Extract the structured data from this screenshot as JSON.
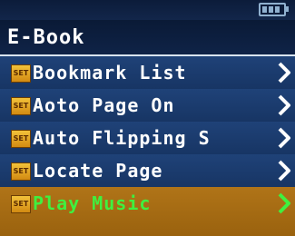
{
  "title": "E-Book",
  "status": {
    "battery_icon": "battery-icon"
  },
  "menu": {
    "items": [
      {
        "label": "Bookmark List",
        "icon_text": "SET",
        "icon": "set-icon",
        "selected": false
      },
      {
        "label": "Aoto Page On",
        "icon_text": "SET",
        "icon": "set-icon",
        "selected": false
      },
      {
        "label": "Auto Flipping S",
        "icon_text": "SET",
        "icon": "set-icon",
        "selected": false
      },
      {
        "label": "Locate Page",
        "icon_text": "SET",
        "icon": "set-icon",
        "selected": false
      },
      {
        "label": "Play Music",
        "icon_text": "SET",
        "icon": "set-icon",
        "selected": true
      }
    ]
  },
  "colors": {
    "background": "#1b3a6e",
    "selected_background": "#a86a12",
    "selected_text": "#3ff03f",
    "text": "#ffffff",
    "chevron": "#ffffff"
  }
}
